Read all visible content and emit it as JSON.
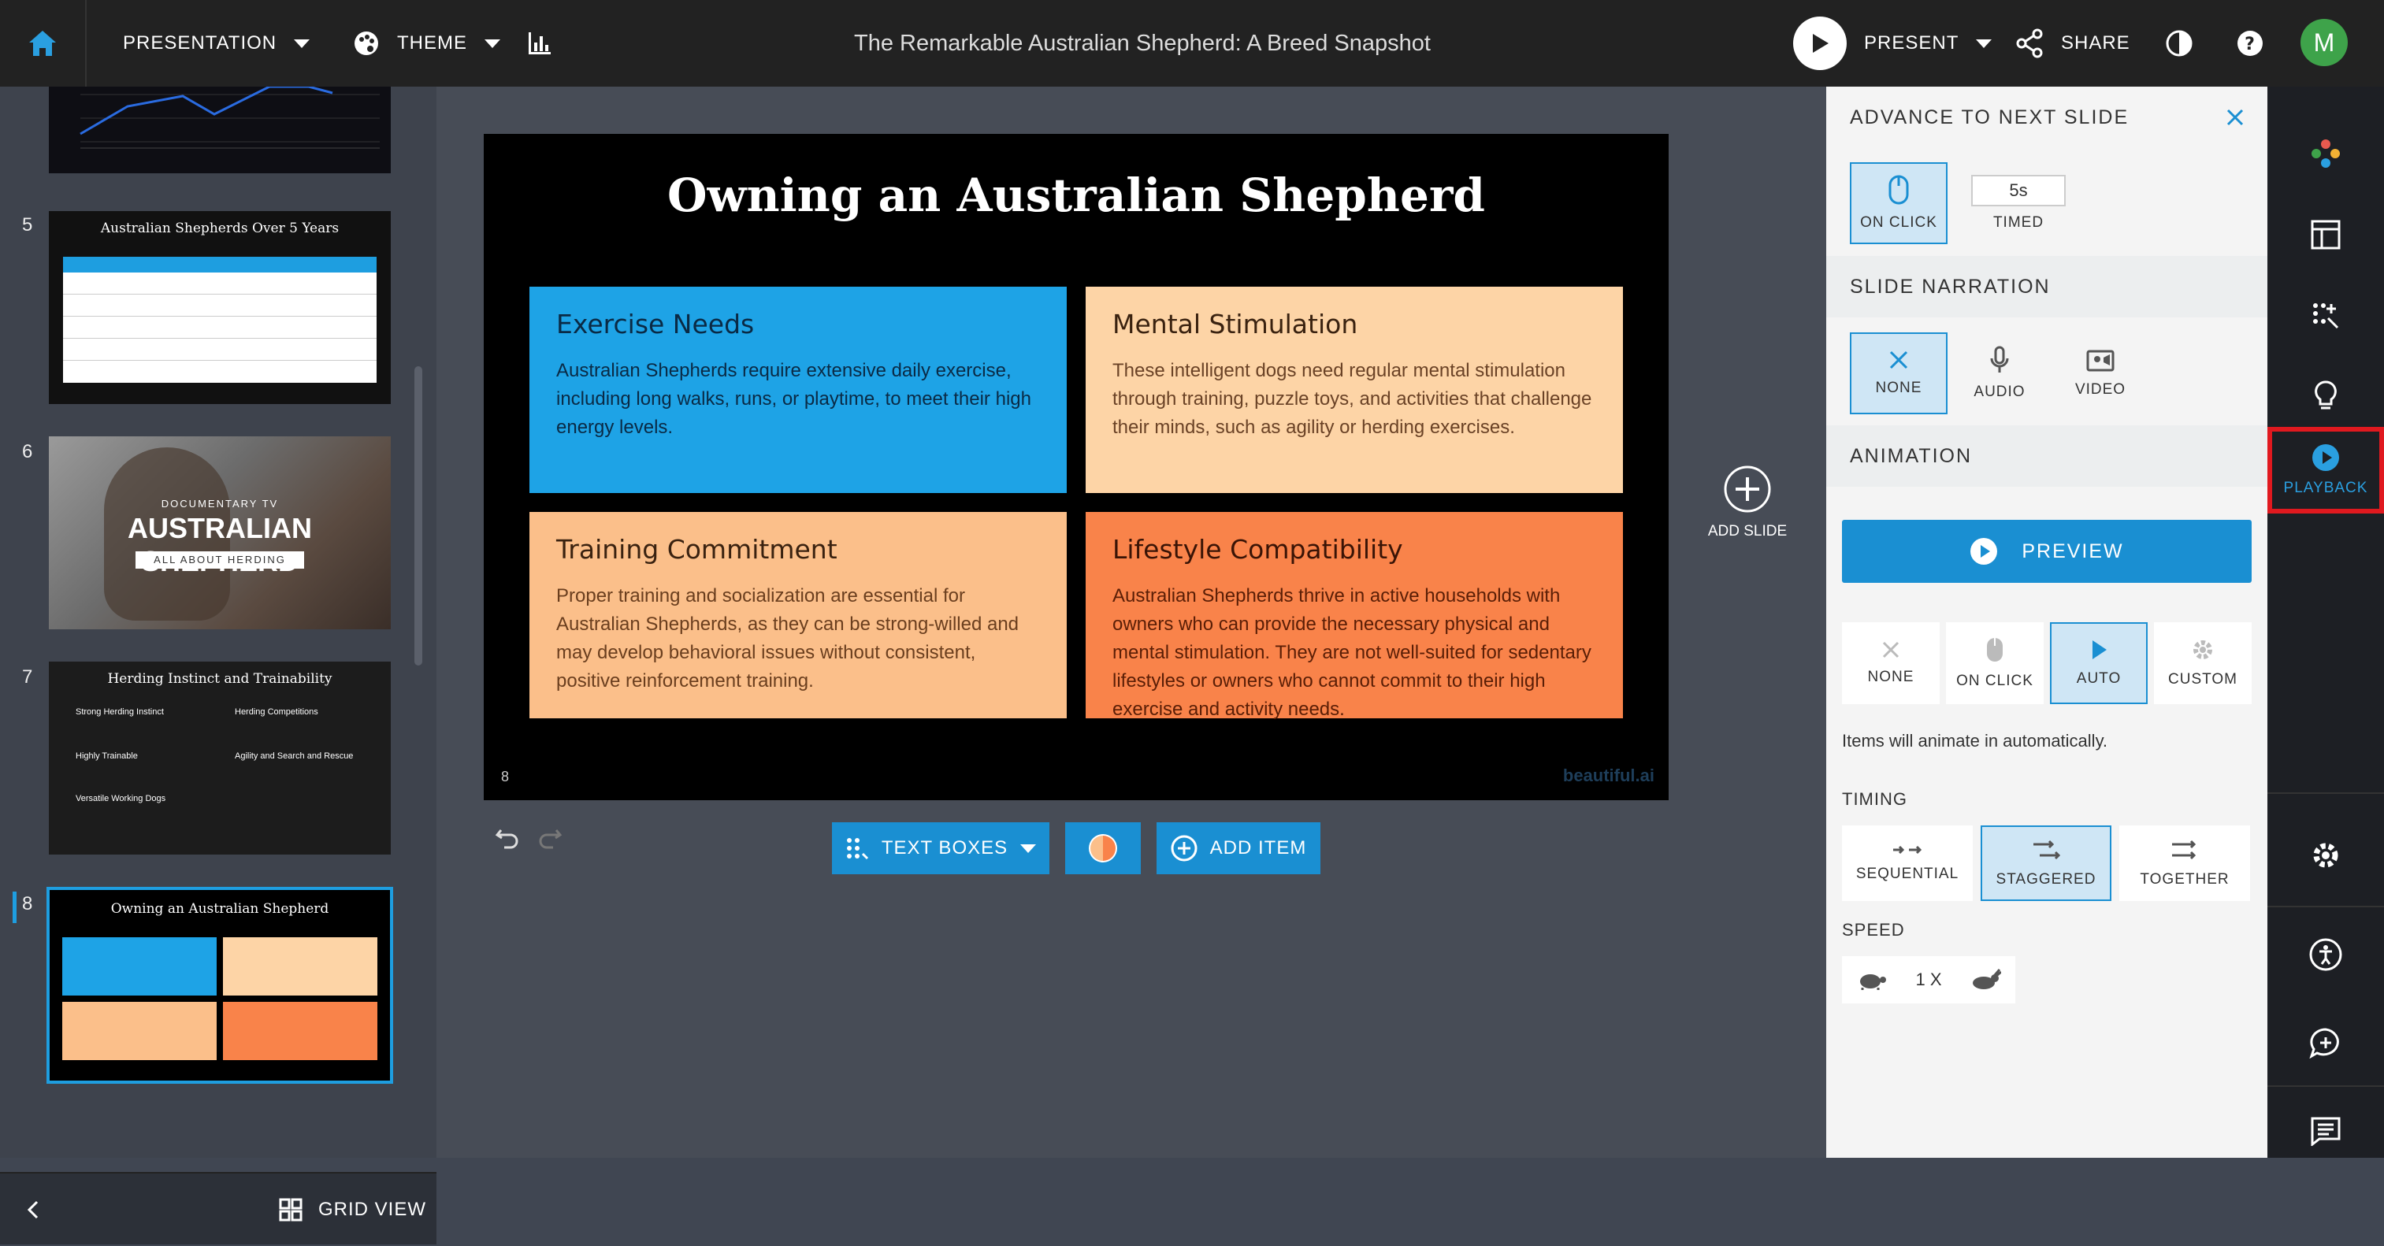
{
  "topbar": {
    "presentation_label": "PRESENTATION",
    "theme_label": "THEME",
    "title": "The Remarkable Australian Shepherd: A Breed Snapshot",
    "present_label": "PRESENT",
    "share_label": "SHARE",
    "avatar_initial": "M"
  },
  "thumbnails": [
    {
      "number": "5",
      "title": "Australian Shepherds Over 5 Years"
    },
    {
      "number": "6",
      "over": "DOCUMENTARY TV",
      "title": "AUSTRALIAN SHEPHERD",
      "sub": "ALL ABOUT HERDING"
    },
    {
      "number": "7",
      "title": "Herding Instinct and Trainability",
      "items": [
        "Strong Herding Instinct",
        "Herding Competitions",
        "Highly Trainable",
        "Agility and Search and Rescue",
        "Versatile Working Dogs"
      ]
    },
    {
      "number": "8",
      "title": "Owning an Australian Shepherd"
    }
  ],
  "left_footer": {
    "grid_view_label": "GRID VIEW"
  },
  "slide": {
    "number": "8",
    "title": "Owning an Australian Shepherd",
    "watermark": "beautiful.ai",
    "boxes": [
      {
        "heading": "Exercise Needs",
        "body": "Australian Shepherds require extensive daily exercise, including long walks, runs, or playtime, to meet their high energy levels.",
        "color": "#1ea3e6"
      },
      {
        "heading": "Mental Stimulation",
        "body": "These intelligent dogs need regular mental stimulation through training, puzzle toys, and activities that challenge their minds, such as agility or herding exercises.",
        "color": "#fdd4a6"
      },
      {
        "heading": "Training Commitment",
        "body": "Proper training and socialization are essential for Australian Shepherds, as they can be strong-willed and may develop behavioral issues without consistent, positive reinforcement training.",
        "color": "#fbbf8a"
      },
      {
        "heading": "Lifestyle Compatibility",
        "body": "Australian Shepherds thrive in active households with owners who can provide the necessary physical and mental stimulation. They are not well-suited for sedentary lifestyles or owners who cannot commit to their high exercise and activity needs.",
        "color": "#f9834a"
      }
    ]
  },
  "canvas": {
    "add_slide_label": "ADD SLIDE",
    "text_boxes_label": "TEXT BOXES",
    "add_item_label": "ADD ITEM"
  },
  "panel": {
    "advance_heading": "ADVANCE TO NEXT SLIDE",
    "on_click_label": "ON CLICK",
    "timed_value": "5s",
    "timed_label": "TIMED",
    "narration_heading": "SLIDE NARRATION",
    "narration_options": [
      "NONE",
      "AUDIO",
      "VIDEO"
    ],
    "animation_heading": "ANIMATION",
    "preview_label": "PREVIEW",
    "animation_options": [
      "NONE",
      "ON CLICK",
      "AUTO",
      "CUSTOM"
    ],
    "animation_selected": "AUTO",
    "animation_note": "Items will animate in automatically.",
    "timing_heading": "TIMING",
    "timing_options": [
      "SEQUENTIAL",
      "STAGGERED",
      "TOGETHER"
    ],
    "timing_selected": "STAGGERED",
    "speed_heading": "SPEED",
    "speed_value": "1 X"
  },
  "iconbar": {
    "playback_label": "PLAYBACK"
  },
  "colors": {
    "accent": "#1a8fd2",
    "highlight_border": "#e0191f",
    "avatar": "#3ea34a"
  }
}
